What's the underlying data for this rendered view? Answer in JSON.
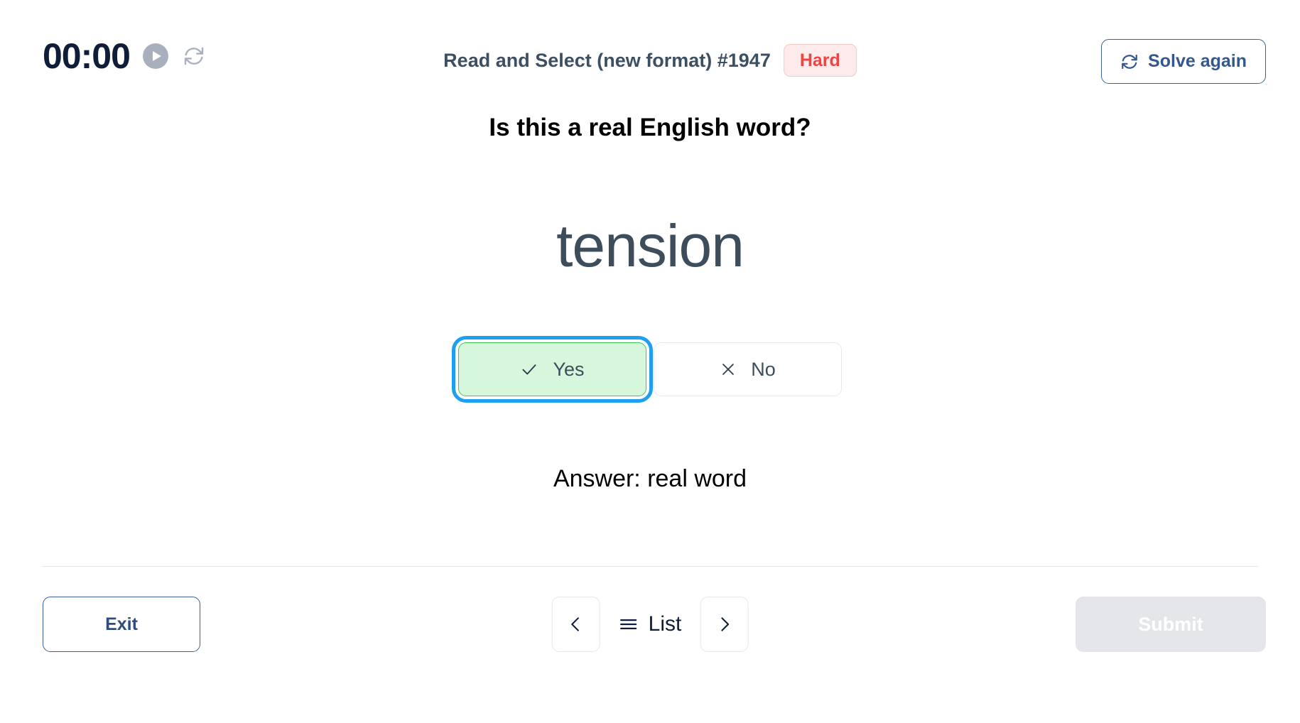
{
  "header": {
    "timer": "00:00",
    "play_icon": "play-circle-icon",
    "reset_icon": "refresh-icon",
    "exercise_title": "Read and Select (new format) #1947",
    "difficulty": "Hard",
    "solve_again_label": "Solve again",
    "solve_again_icon": "refresh-icon"
  },
  "main": {
    "question": "Is this a real English word?",
    "word": "tension",
    "choices": [
      {
        "label": "Yes",
        "icon": "check-icon",
        "selected": true
      },
      {
        "label": "No",
        "icon": "close-icon",
        "selected": false
      }
    ],
    "answer_text": "Answer: real word"
  },
  "footer": {
    "exit_label": "Exit",
    "prev_icon": "chevron-left-icon",
    "list_label": "List",
    "list_icon": "hamburger-icon",
    "next_icon": "chevron-right-icon",
    "submit_label": "Submit"
  },
  "colors": {
    "accent_blue": "#34578c",
    "focus_blue": "#1e9ff2",
    "selected_green_bg": "#d7f7dd",
    "selected_green_border": "#3cc95b",
    "danger_red": "#ef4444",
    "danger_red_bg": "#fdeaea",
    "text_dark": "#0f1e38",
    "text_slate": "#3d4d5c",
    "disabled_gray": "#e4e6e9"
  }
}
